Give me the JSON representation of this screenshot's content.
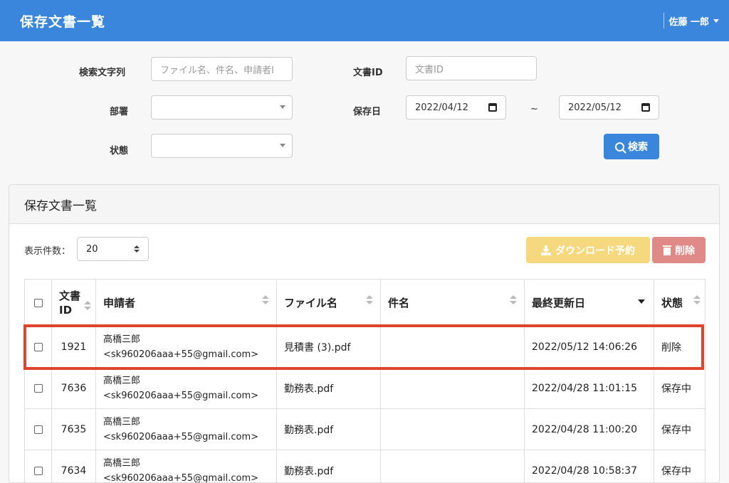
{
  "header": {
    "title": "保存文書一覧",
    "user": "佐藤 一郎"
  },
  "search": {
    "keyword_label": "検索文字列",
    "keyword_placeholder": "ファイル名、件名、申請者I",
    "docid_label": "文書ID",
    "docid_placeholder": "文書ID",
    "dept_label": "部署",
    "date_label": "保存日",
    "date_from": "2022/04/12",
    "date_sep": "~",
    "date_to": "2022/05/12",
    "status_label": "状態",
    "search_button": "検索"
  },
  "panel": {
    "title": "保存文書一覧",
    "pagesize_label": "表示件数：",
    "pagesize_value": "20",
    "download_button": "ダウンロード予約",
    "delete_button": "削除"
  },
  "table": {
    "columns": [
      "文書ID",
      "申請者",
      "ファイル名",
      "件名",
      "最終更新日",
      "状態"
    ],
    "rows": [
      {
        "id": "1921",
        "applicant_name": "高橋三郎",
        "applicant_email": "<sk960206aaa+55@gmail.com>",
        "file": "見積書 (3).pdf",
        "subject": "",
        "updated": "2022/05/12 14:06:26",
        "status": "削除"
      },
      {
        "id": "7636",
        "applicant_name": "高橋三郎",
        "applicant_email": "<sk960206aaa+55@gmail.com>",
        "file": "勤務表.pdf",
        "subject": "",
        "updated": "2022/04/28 11:01:15",
        "status": "保存中"
      },
      {
        "id": "7635",
        "applicant_name": "高橋三郎",
        "applicant_email": "<sk960206aaa+55@gmail.com>",
        "file": "勤務表.pdf",
        "subject": "",
        "updated": "2022/04/28 11:00:20",
        "status": "保存中"
      },
      {
        "id": "7634",
        "applicant_name": "高橋三郎",
        "applicant_email": "<sk960206aaa+55@gmail.com>",
        "file": "勤務表.pdf",
        "subject": "",
        "updated": "2022/04/28 10:58:37",
        "status": "保存中"
      }
    ]
  },
  "colors": {
    "primary": "#3a86dc",
    "warning": "#f6d87e",
    "danger": "#e08a87",
    "highlight": "#e0442c"
  }
}
